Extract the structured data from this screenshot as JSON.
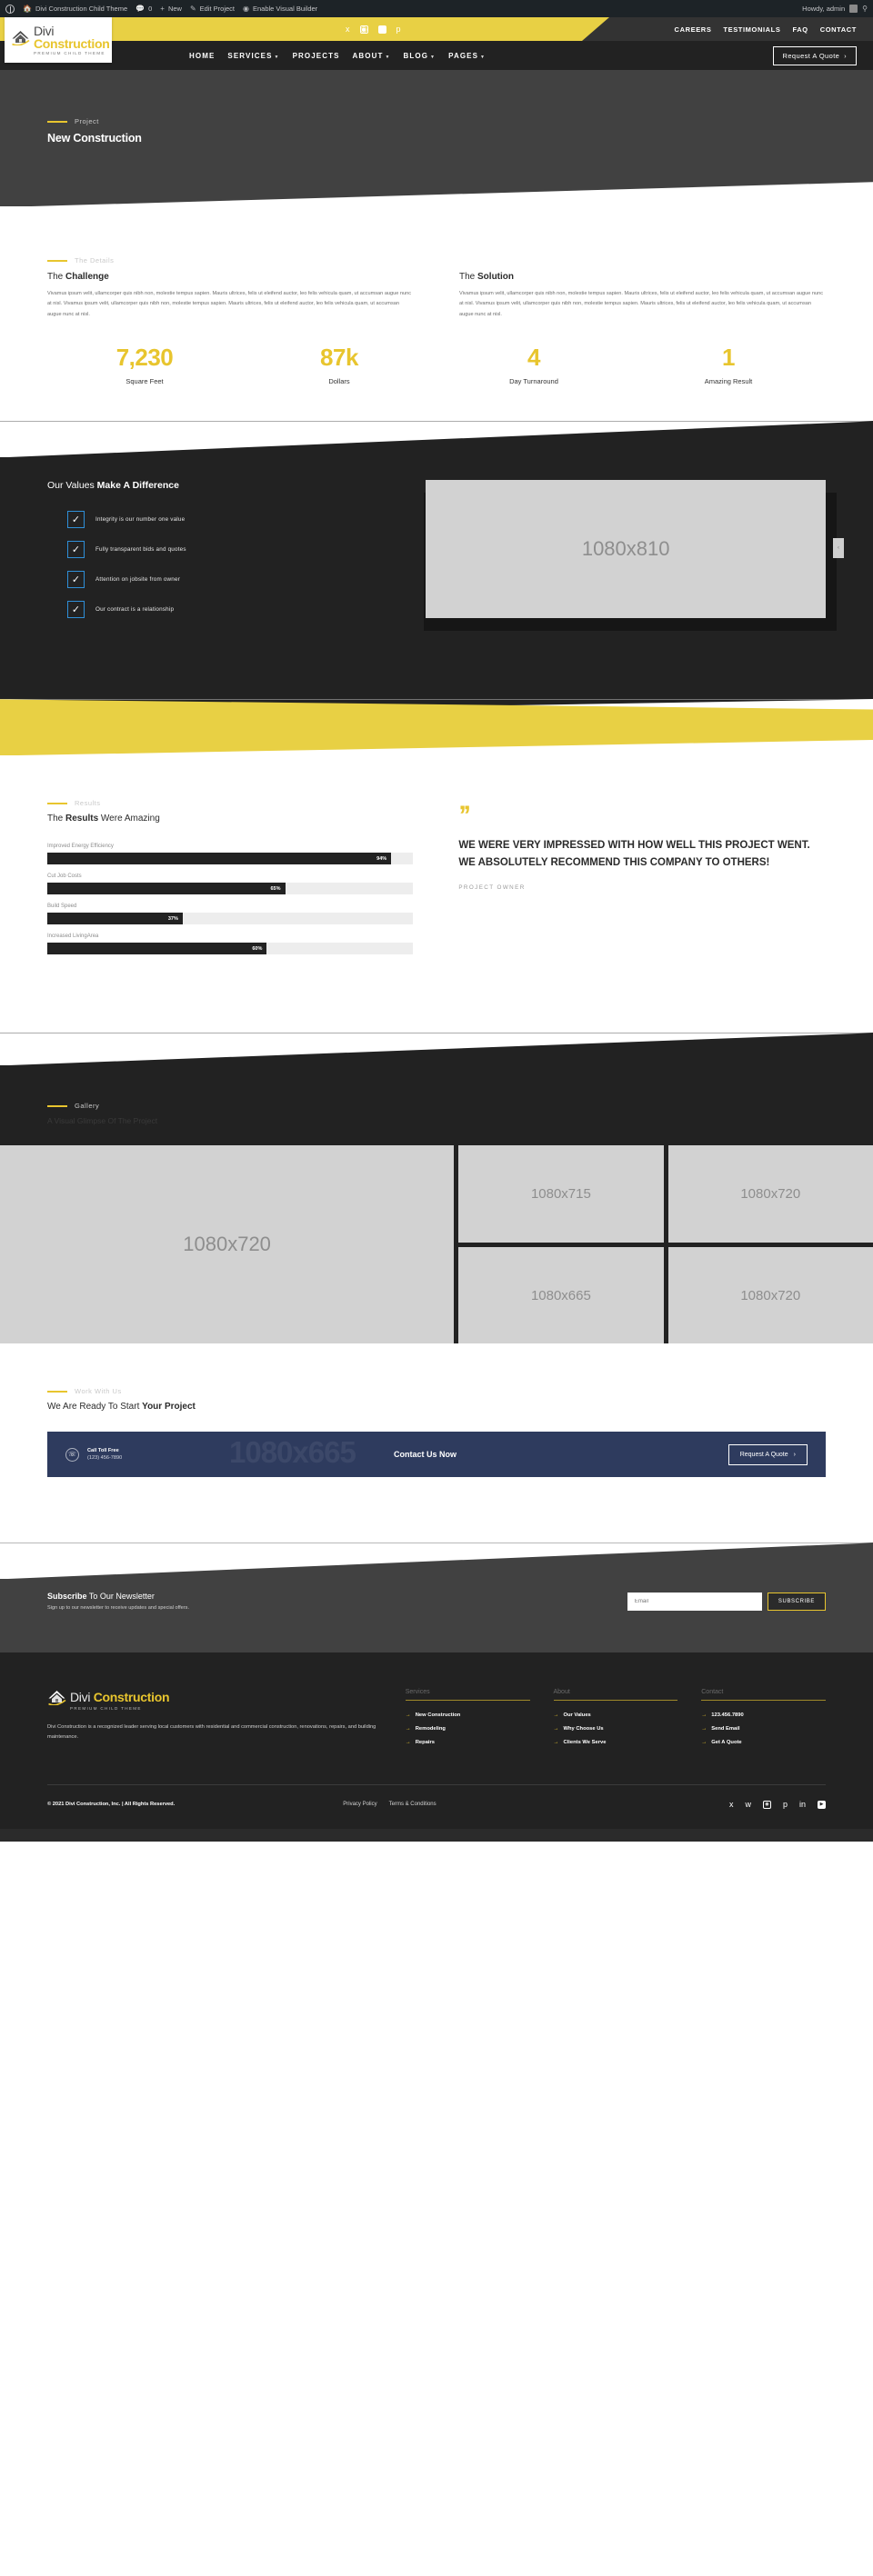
{
  "admin_bar": {
    "items": [
      "Divi Construction Child Theme",
      "0",
      "New",
      "Edit Project",
      "Enable Visual Builder"
    ],
    "howdy": "Howdy, admin"
  },
  "topbar": {
    "socials": [
      "facebook-icon",
      "instagram-icon",
      "youtube-icon",
      "pinterest-icon"
    ],
    "links": [
      "CAREERS",
      "TESTIMONIALS",
      "FAQ",
      "CONTACT"
    ]
  },
  "logo": {
    "part1": "Divi",
    "part2": "Construction",
    "sub": "PREMIUM CHILD THEME"
  },
  "nav": {
    "items": [
      {
        "label": "HOME",
        "caret": false
      },
      {
        "label": "SERVICES",
        "caret": true
      },
      {
        "label": "PROJECTS",
        "caret": false
      },
      {
        "label": "ABOUT",
        "caret": true
      },
      {
        "label": "BLOG",
        "caret": true
      },
      {
        "label": "PAGES",
        "caret": true
      }
    ],
    "cta": "Request A Quote"
  },
  "hero": {
    "eyebrow": "Project",
    "title": "New Construction"
  },
  "details": {
    "eyebrow": "The Details",
    "left_title_plain": "The ",
    "left_title_bold": "Challenge",
    "right_title_plain": "The ",
    "right_title_bold": "Solution",
    "body": "Vivamus ipsum velit, ullamcorper quis nibh non, molestie tempus sapien. Mauris ultrices, felis ut eleifend auctor, leo felis vehicula quam, ut accumsan augue nunc at nisl. Vivamus ipsum velit, ullamcorper quis nibh non, molestie tempus sapien. Mauris ultrices, felis ut eleifend auctor, leo felis vehicula quam, ut accumsan augue nunc at nisl."
  },
  "stats": [
    {
      "num": "7,230",
      "label": "Square Feet"
    },
    {
      "num": "87k",
      "label": "Dollars"
    },
    {
      "num": "4",
      "label": "Day Turnaround"
    },
    {
      "num": "1",
      "label": "Amazing Result"
    }
  ],
  "values": {
    "title_plain": "Our Values ",
    "title_bold": "Make A Difference",
    "items": [
      "Integrity is our number one value",
      "Fully transparent bids and quotes",
      "Attention on jobsite from owner",
      "Our contract is a relationship"
    ],
    "image_label": "1080x810",
    "tab_label": "‹"
  },
  "results": {
    "eyebrow": "Results",
    "title_plain": "The ",
    "title_bold": "Results",
    "title_plain2": " Were Amazing",
    "bars": [
      {
        "label": "Improved Energy Efficiency",
        "value": 94,
        "value_label": "94%"
      },
      {
        "label": "Cut Job Costs",
        "value": 65,
        "value_label": "65%"
      },
      {
        "label": "Build Speed",
        "value": 37,
        "value_label": "37%"
      },
      {
        "label": "Increased LivingArea",
        "value": 60,
        "value_label": "60%"
      }
    ],
    "quote_mark": "’’",
    "quote": "WE WERE VERY IMPRESSED WITH HOW WELL THIS PROJECT WENT. WE ABSOLUTELY RECOMMEND THIS COMPANY TO OTHERS!",
    "attribution": "PROJECT OWNER"
  },
  "gallery": {
    "eyebrow": "Gallery",
    "title": "A Visual Glimpse Of The Project",
    "images": [
      "1080x720",
      "1080x715",
      "1080x720",
      "1080x665",
      "1080x720"
    ]
  },
  "cta": {
    "eyebrow": "Work With Us",
    "title_plain": "We Are Ready To Start ",
    "title_bold": "Your Project",
    "ghost": "1080x665",
    "phone_icon": "phone-icon",
    "phone_label": "Call Toll Free",
    "phone_number": "(123) 456-7890",
    "middle": "Contact Us Now",
    "button": "Request A Quote"
  },
  "newsletter": {
    "title_bold": "Subscribe",
    "title_plain": " To Our Newsletter",
    "subtitle": "Sign up to our newsletter to receive updates and special offers.",
    "input_placeholder": "Email",
    "input_value": "",
    "button": "SUBSCRIBE"
  },
  "footer": {
    "about": "Divi Construction is a recognized leader serving local customers with residential and commercial construction, renovations,  repairs, and building maintenance.",
    "columns": [
      {
        "title": "Services",
        "links": [
          "New Construction",
          "Remodeling",
          "Repairs"
        ]
      },
      {
        "title": "About",
        "links": [
          "Our Values",
          "Why Choose Us",
          "Clients We Serve"
        ]
      },
      {
        "title": "Contact",
        "links": [
          "123.456.7890",
          "Send Email",
          "Get A Quote"
        ]
      }
    ],
    "copyright": "© 2021 Divi Construction, Inc. | All Rights Reserved.",
    "legal": [
      "Privacy Policy",
      "Terms & Conditions"
    ],
    "socials": [
      "facebook-icon",
      "twitter-icon",
      "instagram-icon",
      "pinterest-icon",
      "linkedin-icon",
      "youtube-icon"
    ]
  },
  "colors": {
    "accent": "#e8c52e",
    "band": "#e8d044",
    "dark": "#222222",
    "hero": "#414141",
    "cta": "#2e3b5e",
    "check": "#2f8fd8"
  }
}
